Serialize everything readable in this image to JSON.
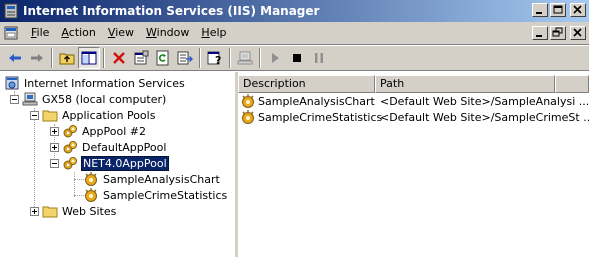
{
  "window": {
    "title": "Internet Information Services (IIS) Manager"
  },
  "menu": [
    {
      "label": "File",
      "key": "F",
      "rest": "ile"
    },
    {
      "label": "Action",
      "key": "A",
      "rest": "ction"
    },
    {
      "label": "View",
      "key": "V",
      "rest": "iew"
    },
    {
      "label": "Window",
      "key": "W",
      "rest": "indow"
    },
    {
      "label": "Help",
      "key": "H",
      "rest": "elp"
    }
  ],
  "toolbar_icons": [
    "back-icon",
    "forward-icon",
    "up-folder-icon",
    "show-hide-tree-icon",
    "delete-icon",
    "properties-icon",
    "refresh-icon",
    "export-list-icon",
    "help-icon",
    "computer-icon",
    "start-icon",
    "stop-icon",
    "pause-icon"
  ],
  "tree": {
    "root": "Internet Information Services",
    "computer": "GX58 (local computer)",
    "app_pools": "Application Pools",
    "pools": [
      "AppPool #2",
      "DefaultAppPool",
      "NET4.0AppPool"
    ],
    "apps": [
      "SampleAnalysisChart",
      "SampleCrimeStatistics"
    ],
    "web_sites": "Web Sites"
  },
  "list": {
    "columns": [
      "Description",
      "Path"
    ],
    "rows": [
      {
        "description": "SampleAnalysisChart",
        "path": "<Default Web Site>/SampleAnalysi ..."
      },
      {
        "description": "SampleCrimeStatistics",
        "path": "<Default Web Site>/SampleCrimeSt ..."
      }
    ]
  },
  "colors": {
    "titlebar_start": "#0a246a",
    "titlebar_end": "#a6caf0",
    "face": "#d4d0c8",
    "selection": "#0a246a"
  }
}
